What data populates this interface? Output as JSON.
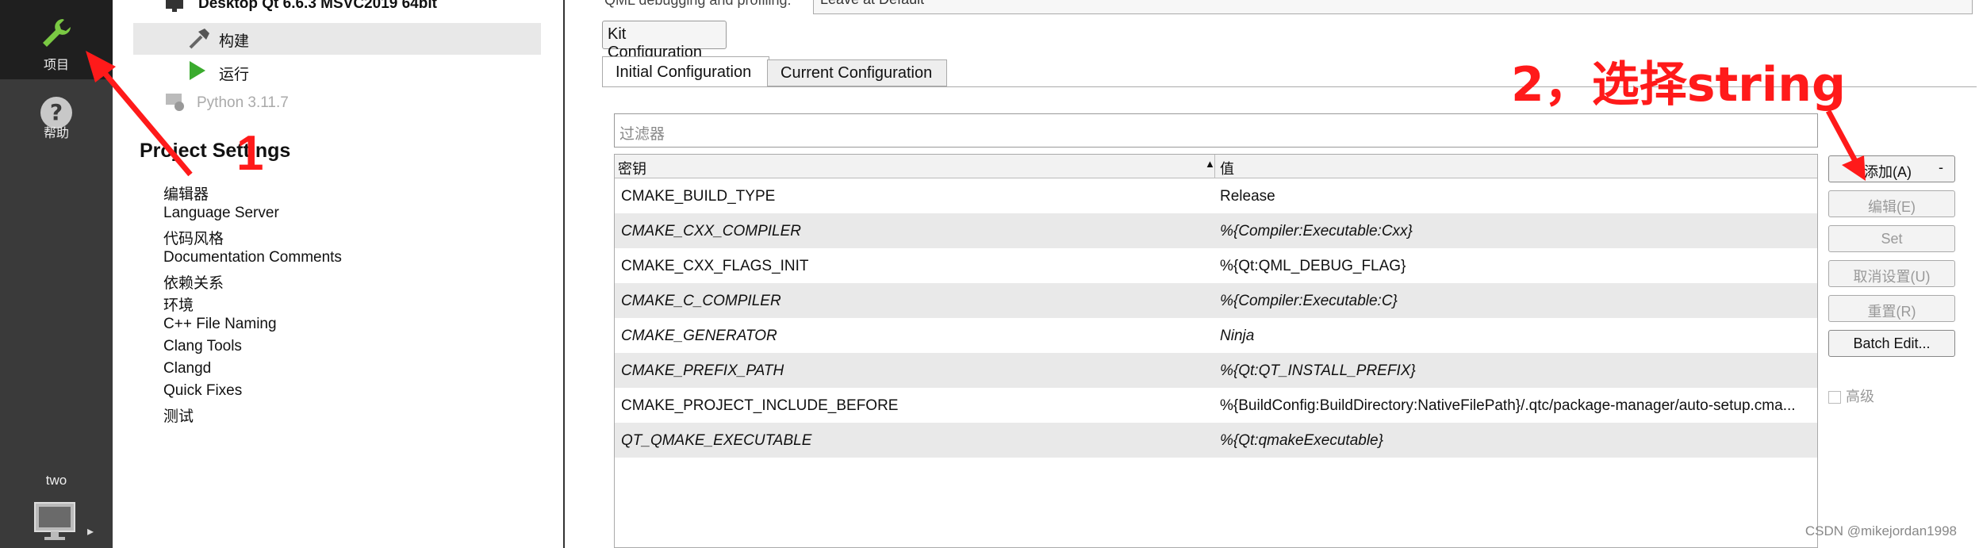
{
  "modebar": {
    "projects_label": "项目",
    "help_label": "帮助",
    "kit_label": "two"
  },
  "tree": {
    "kit_title": "Desktop Qt 6.6.3 MSVC2019 64bit",
    "build": "构建",
    "run": "运行",
    "python": "Python 3.11.7",
    "project_settings_title": "Project Settings",
    "items": [
      "编辑器",
      "Language Server",
      "代码风格",
      "Documentation Comments",
      "依赖关系",
      "环境",
      "C++ File Naming",
      "Clang Tools",
      "Clangd",
      "Quick Fixes",
      "测试"
    ]
  },
  "content": {
    "top_label": "QML debugging and profiling:",
    "top_combo": "Leave at Default",
    "kit_config_button": "Kit Configuration",
    "tabs": [
      "Initial Configuration",
      "Current Configuration"
    ],
    "filter_placeholder": "过滤器",
    "table": {
      "col_key": "密钥",
      "col_value": "值",
      "rows": [
        {
          "key": "CMAKE_BUILD_TYPE",
          "value": "Release"
        },
        {
          "key": "CMAKE_CXX_COMPILER",
          "value": "%{Compiler:Executable:Cxx}"
        },
        {
          "key": "CMAKE_CXX_FLAGS_INIT",
          "value": "%{Qt:QML_DEBUG_FLAG}"
        },
        {
          "key": "CMAKE_C_COMPILER",
          "value": "%{Compiler:Executable:C}"
        },
        {
          "key": "CMAKE_GENERATOR",
          "value": "Ninja"
        },
        {
          "key": "CMAKE_PREFIX_PATH",
          "value": "%{Qt:QT_INSTALL_PREFIX}"
        },
        {
          "key": "CMAKE_PROJECT_INCLUDE_BEFORE",
          "value": "%{BuildConfig:BuildDirectory:NativeFilePath}/.qtc/package-manager/auto-setup.cma..."
        },
        {
          "key": "QT_QMAKE_EXECUTABLE",
          "value": "%{Qt:qmakeExecutable}"
        }
      ]
    },
    "buttons": {
      "add": "添加(A)",
      "add_dash": "-",
      "edit": "编辑(E)",
      "set": "Set",
      "unset": "取消设置(U)",
      "reset": "重置(R)",
      "batch_edit": "Batch Edit..."
    },
    "advanced": "高级"
  },
  "annotations": {
    "step1": "1",
    "step2": "2，选择string",
    "color": "#ff1a1a"
  },
  "watermark": "CSDN @mikejordan1998"
}
